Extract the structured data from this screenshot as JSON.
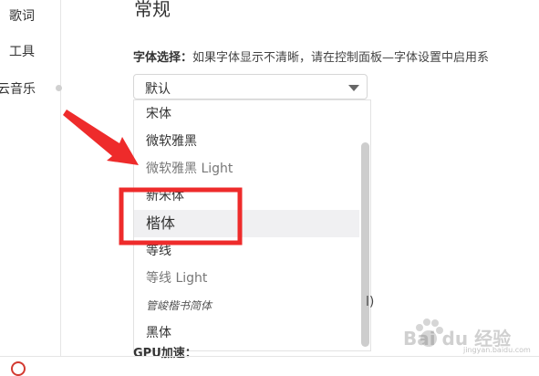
{
  "sidebar": {
    "items": [
      {
        "label": "歌词"
      },
      {
        "label": "工具"
      },
      {
        "label": "云音乐"
      }
    ]
  },
  "section": {
    "title": "常规"
  },
  "font_setting": {
    "label": "字体选择：",
    "hint": "如果字体显示不清晰，请在控制面板—字体设置中启用系",
    "selected": "默认"
  },
  "dropdown": {
    "options": [
      {
        "label": "宋体"
      },
      {
        "label": "微软雅黑"
      },
      {
        "label": "微软雅黑 Light"
      },
      {
        "label": "新宋体"
      },
      {
        "label": "楷体"
      },
      {
        "label": "等线"
      },
      {
        "label": "等线 Light"
      },
      {
        "label": "管峻楷书简体"
      },
      {
        "label": "黑体"
      }
    ],
    "highlighted_index": 4
  },
  "behind": {
    "partial_text": "l)"
  },
  "gpu": {
    "label": "GPU加速："
  },
  "watermark": {
    "text": "Bai du 经验",
    "sub": "jingyan.baidu.com"
  },
  "colors": {
    "annotation_red": "#ee2b2b",
    "highlight_bg": "#f0f0f2"
  }
}
